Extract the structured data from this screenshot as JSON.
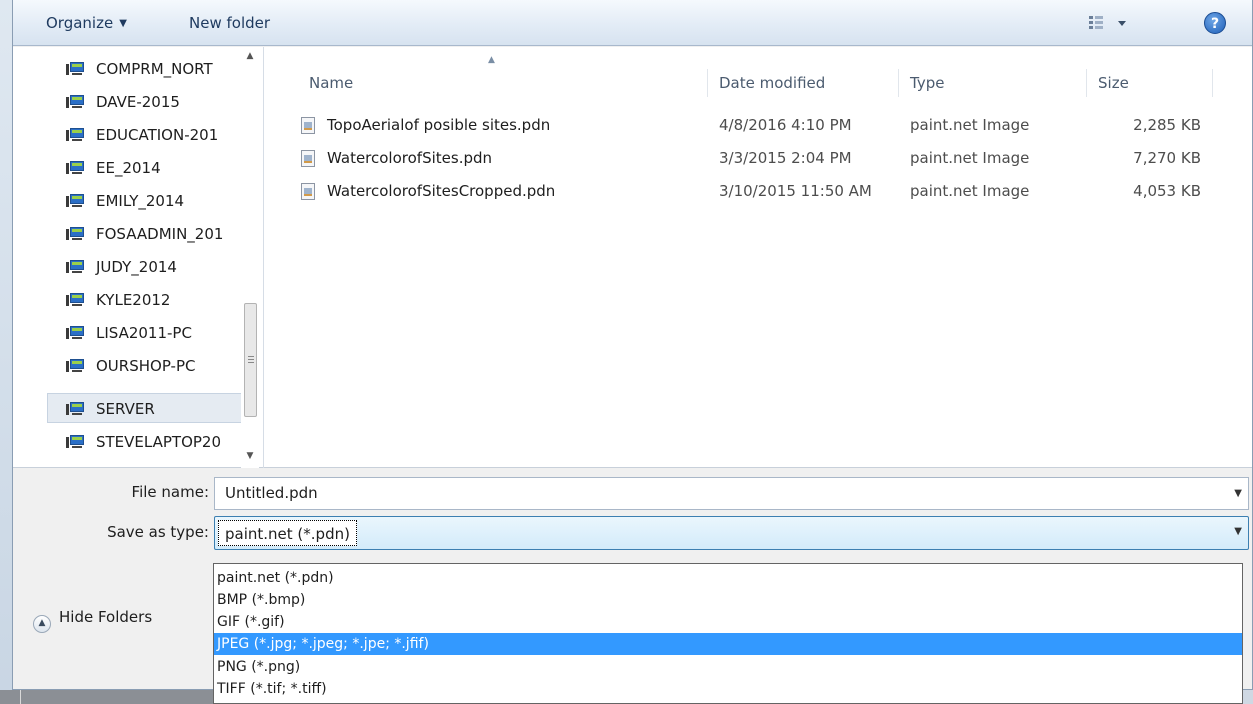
{
  "toolbar": {
    "organize_label": "Organize",
    "new_folder_label": "New folder",
    "view_icon": "view-list-icon",
    "help_label": "?"
  },
  "nav": {
    "items": [
      {
        "label": "COMPRM_NORT"
      },
      {
        "label": "DAVE-2015"
      },
      {
        "label": "EDUCATION-201"
      },
      {
        "label": "EE_2014"
      },
      {
        "label": "EMILY_2014"
      },
      {
        "label": "FOSAADMIN_201"
      },
      {
        "label": "JUDY_2014"
      },
      {
        "label": "KYLE2012"
      },
      {
        "label": "LISA2011-PC"
      },
      {
        "label": "OURSHOP-PC"
      },
      {
        "label": "SERVER"
      },
      {
        "label": "STEVELAPTOP20"
      }
    ],
    "selected": "SERVER"
  },
  "files": {
    "columns": {
      "name": "Name",
      "date": "Date modified",
      "type": "Type",
      "size": "Size"
    },
    "rows": [
      {
        "name": "TopoAerialof posible sites.pdn",
        "date": "4/8/2016 4:10 PM",
        "type": "paint.net Image",
        "size": "2,285 KB"
      },
      {
        "name": "WatercolorofSites.pdn",
        "date": "3/3/2015 2:04 PM",
        "type": "paint.net Image",
        "size": "7,270 KB"
      },
      {
        "name": "WatercolorofSitesCropped.pdn",
        "date": "3/10/2015 11:50 AM",
        "type": "paint.net Image",
        "size": "4,053 KB"
      }
    ]
  },
  "form": {
    "filename_label": "File name:",
    "filename_value": "Untitled.pdn",
    "savetype_label": "Save as type:",
    "savetype_value": "paint.net (*.pdn)"
  },
  "dropdown": {
    "options": [
      "paint.net (*.pdn)",
      "BMP (*.bmp)",
      "GIF (*.gif)",
      "JPEG (*.jpg; *.jpeg; *.jpe; *.jfif)",
      "PNG (*.png)",
      "TIFF (*.tif; *.tiff)"
    ],
    "highlighted": "JPEG (*.jpg; *.jpeg; *.jpe; *.jfif)"
  },
  "footer": {
    "hide_folders_label": "Hide Folders"
  },
  "colors": {
    "highlight": "#3399ff",
    "selection_border": "#3c7fb1"
  }
}
